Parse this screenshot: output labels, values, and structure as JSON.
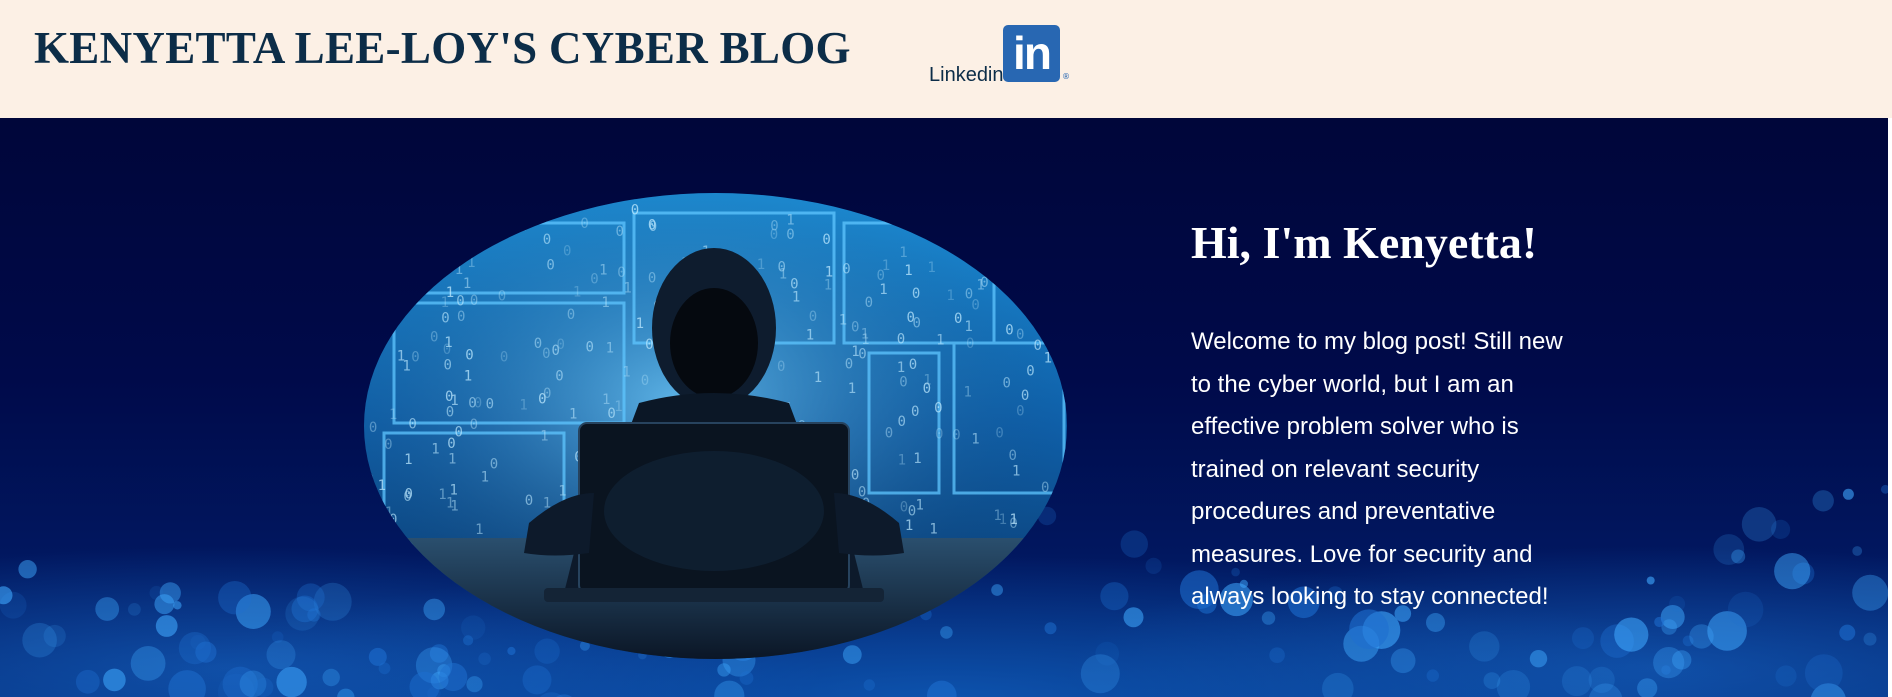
{
  "header": {
    "title": "KENYETTA LEE-LOY'S CYBER BLOG",
    "linkedin_label": "Linkedin",
    "linkedin_logo_text": "in",
    "linkedin_reg_mark": "®"
  },
  "hero": {
    "image_alt_icon": "hooded-hacker-laptop-image",
    "heading": "Hi, I'm Kenyetta!",
    "intro": "Welcome to my blog post! Still new to the cyber world, but I am an effective problem solver who is trained on relevant security procedures and preventative measures. Love for security and always looking to stay connected!"
  },
  "colors": {
    "header_bg": "#fcf0e5",
    "title_color": "#0c2d48",
    "linkedin_blue": "#2867b2",
    "hero_bg": "#00063a",
    "hero_text": "#ffffff"
  }
}
